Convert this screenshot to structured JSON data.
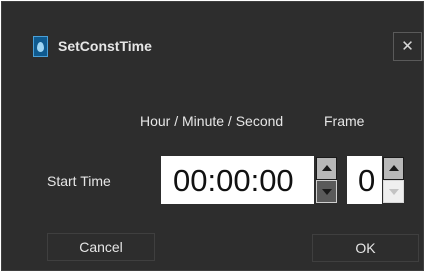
{
  "window": {
    "title": "SetConstTime",
    "close_glyph": "✕",
    "icon": "app-drop-icon"
  },
  "headers": {
    "time": "Hour / Minute / Second",
    "frame": "Frame"
  },
  "start_time": {
    "label": "Start Time",
    "value": "00:00:00",
    "frame": "0"
  },
  "buttons": {
    "cancel": "Cancel",
    "ok": "OK"
  },
  "colors": {
    "background": "#2d2d2d",
    "text": "#e6e6e6",
    "field": "#ffffff"
  }
}
